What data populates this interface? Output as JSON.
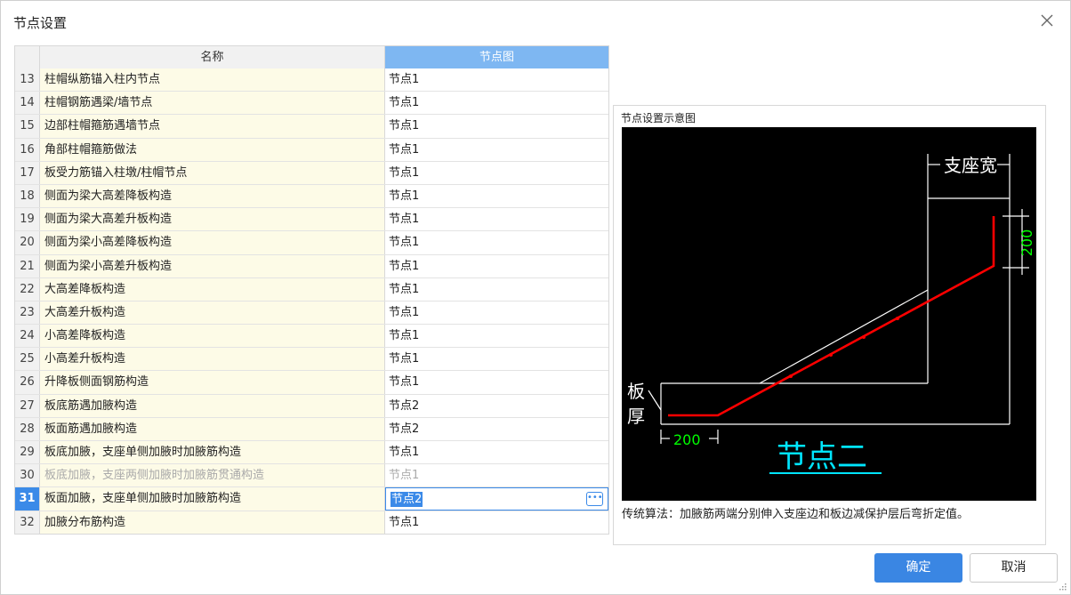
{
  "dialog": {
    "title": "节点设置",
    "close_icon": "close-icon"
  },
  "table": {
    "headers": {
      "name": "名称",
      "node": "节点图"
    },
    "rows": [
      {
        "num": "13",
        "name": "柱帽纵筋锚入柱内节点",
        "node": "节点1"
      },
      {
        "num": "14",
        "name": "柱帽钢筋遇梁/墙节点",
        "node": "节点1"
      },
      {
        "num": "15",
        "name": "边部柱帽箍筋遇墙节点",
        "node": "节点1"
      },
      {
        "num": "16",
        "name": "角部柱帽箍筋做法",
        "node": "节点1"
      },
      {
        "num": "17",
        "name": "板受力筋锚入柱墩/柱帽节点",
        "node": "节点1"
      },
      {
        "num": "18",
        "name": "侧面为梁大高差降板构造",
        "node": "节点1"
      },
      {
        "num": "19",
        "name": "侧面为梁大高差升板构造",
        "node": "节点1"
      },
      {
        "num": "20",
        "name": "侧面为梁小高差降板构造",
        "node": "节点1"
      },
      {
        "num": "21",
        "name": "侧面为梁小高差升板构造",
        "node": "节点1"
      },
      {
        "num": "22",
        "name": "大高差降板构造",
        "node": "节点1"
      },
      {
        "num": "23",
        "name": "大高差升板构造",
        "node": "节点1"
      },
      {
        "num": "24",
        "name": "小高差降板构造",
        "node": "节点1"
      },
      {
        "num": "25",
        "name": "小高差升板构造",
        "node": "节点1"
      },
      {
        "num": "26",
        "name": "升降板侧面钢筋构造",
        "node": "节点1"
      },
      {
        "num": "27",
        "name": "板底筋遇加腋构造",
        "node": "节点2"
      },
      {
        "num": "28",
        "name": "板面筋遇加腋构造",
        "node": "节点2"
      },
      {
        "num": "29",
        "name": "板底加腋，支座单侧加腋时加腋筋构造",
        "node": "节点1"
      },
      {
        "num": "30",
        "name": "板底加腋，支座两侧加腋时加腋筋贯通构造",
        "node": "节点1",
        "disabled": true
      },
      {
        "num": "31",
        "name": "板面加腋，支座单侧加腋时加腋筋构造",
        "node": "节点2",
        "selected": true
      },
      {
        "num": "32",
        "name": "加腋分布筋构造",
        "node": "节点1"
      }
    ]
  },
  "preview": {
    "title": "节点设置示意图",
    "description": "传统算法：加腋筋两端分别伸入支座边和板边减保护层后弯折定值。",
    "diagram": {
      "support_width_label": "支座宽",
      "dim_top": "200",
      "dim_bottom": "200",
      "slab_label_1": "板",
      "slab_label_2": "厚",
      "node_title": "节点二"
    }
  },
  "buttons": {
    "ok": "确定",
    "cancel": "取消"
  },
  "colors": {
    "accent": "#3a86e3",
    "header_active": "#7eb7f2",
    "rebar": "#ff0000",
    "dim": "#00ff00",
    "node_title": "#00e5ff"
  }
}
